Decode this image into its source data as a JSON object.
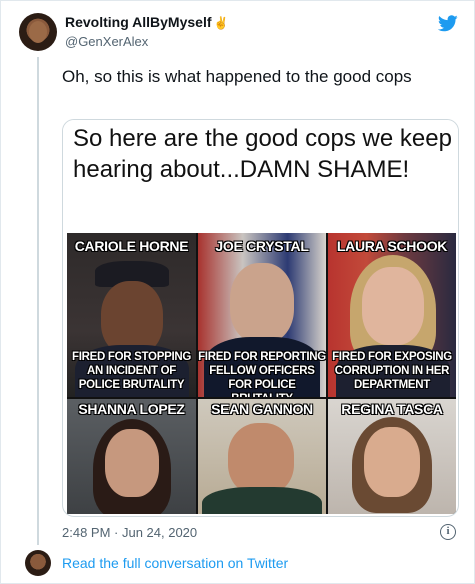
{
  "tweet": {
    "author_name": "Revolting AllByMyself",
    "author_emoji": "✌",
    "author_handle": "@GenXerAlex",
    "text": "Oh, so this is what happened to the good cops",
    "timestamp": "2:48 PM · Jun 24, 2020",
    "read_more": "Read the full conversation on Twitter",
    "info_icon_glyph": "i"
  },
  "media": {
    "title": "So here are the good cops we keep hearing about...DAMN SHAME!",
    "people": [
      {
        "name": "CARIOLE HORNE",
        "caption": "FIRED FOR STOPPING AN INCIDENT OF POLICE BRUTALITY"
      },
      {
        "name": "JOE CRYSTAL",
        "caption": "FIRED FOR REPORTING FELLOW OFFICERS FOR POLICE BRUTALITY"
      },
      {
        "name": "LAURA SCHOOK",
        "caption": "FIRED FOR EXPOSING CORRUPTION IN HER DEPARTMENT"
      },
      {
        "name": "SHANNA LOPEZ",
        "caption": ""
      },
      {
        "name": "SEAN GANNON",
        "caption": ""
      },
      {
        "name": "REGINA TASCA",
        "caption": ""
      }
    ]
  },
  "colors": {
    "link": "#1d9bf0",
    "twitter_blue": "#1d9bf0",
    "muted": "#536471"
  }
}
